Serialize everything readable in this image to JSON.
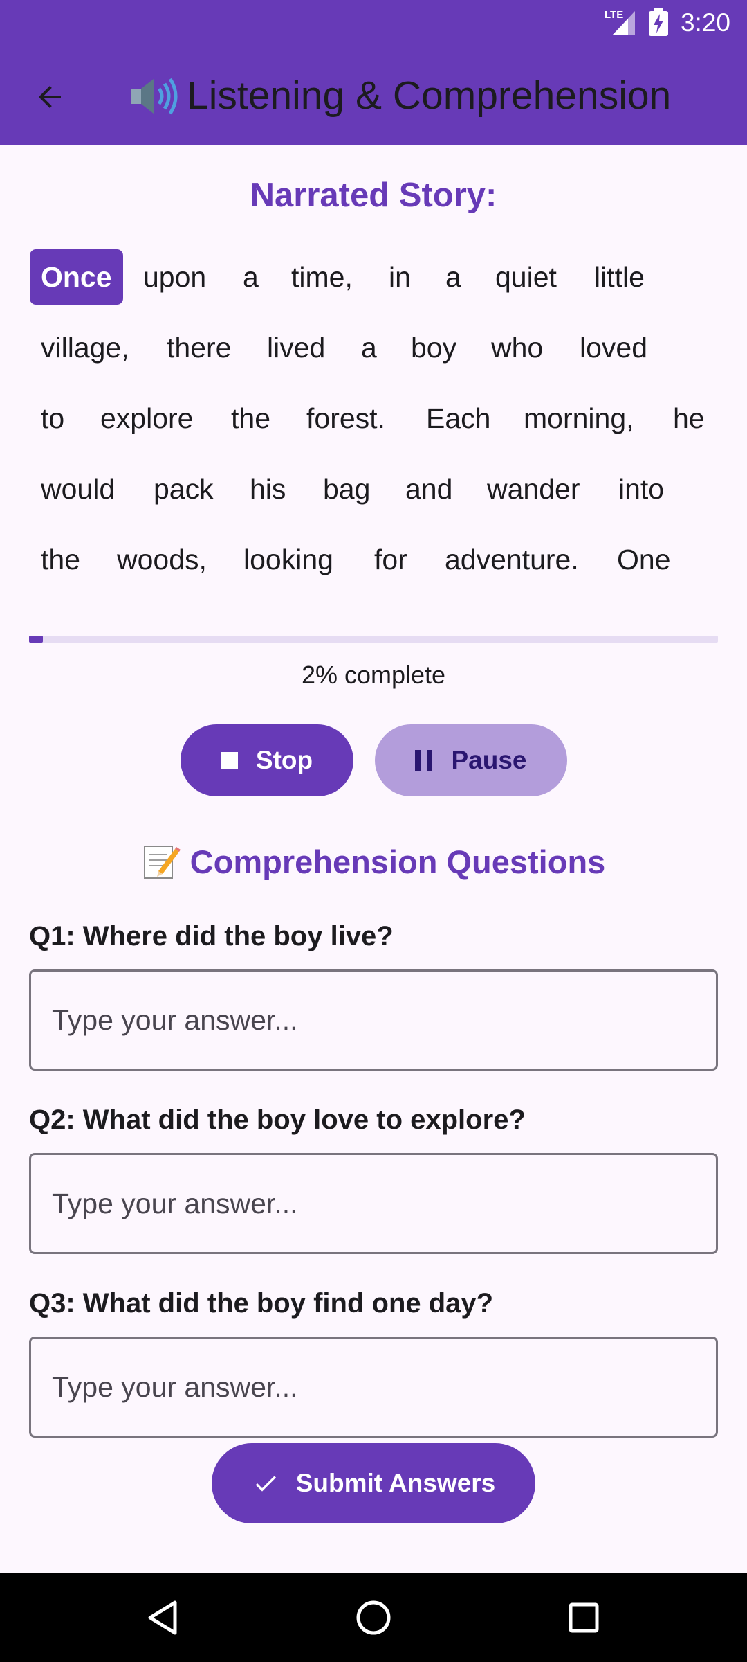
{
  "status_bar": {
    "time": "3:20",
    "network_label": "LTE",
    "icons": [
      "lte-signal-icon",
      "battery-charging-icon"
    ]
  },
  "app_bar": {
    "title": "Listening & Comprehension",
    "back_icon": "arrow-back-icon",
    "title_icon": "speaker-icon"
  },
  "story": {
    "heading": "Narrated Story:",
    "active_word_index": 0,
    "lines": [
      [
        "Once",
        "upon",
        "a",
        "time,",
        "in",
        "a",
        "quiet",
        "little"
      ],
      [
        "village,",
        "there",
        "lived",
        "a",
        "boy",
        "who",
        "loved"
      ],
      [
        "to",
        "explore",
        "the",
        "forest.",
        "Each",
        "morning,",
        "he"
      ],
      [
        "would",
        "pack",
        "his",
        "bag",
        "and",
        "wander",
        "into"
      ],
      [
        "the",
        "woods,",
        "looking",
        "for",
        "adventure.",
        "One"
      ]
    ],
    "progress_percent": 2,
    "progress_text": "2% complete"
  },
  "controls": {
    "stop_label": "Stop",
    "pause_label": "Pause"
  },
  "questions": {
    "heading": "Comprehension Questions",
    "heading_icon": "memo-icon",
    "items": [
      {
        "label": "Q1: Where did the boy live?",
        "placeholder": "Type your answer...",
        "value": ""
      },
      {
        "label": "Q2: What did the boy love to explore?",
        "placeholder": "Type your answer...",
        "value": ""
      },
      {
        "label": "Q3: What did the boy find one day?",
        "placeholder": "Type your answer...",
        "value": ""
      }
    ],
    "submit_label": "Submit Answers"
  },
  "nav_bar": {
    "icons": [
      "nav-back-icon",
      "nav-home-icon",
      "nav-recents-icon"
    ]
  },
  "colors": {
    "primary": "#673ab7",
    "secondary_button": "#b39ddb",
    "background": "#fdf7fe",
    "progress_track": "#e6dcf3"
  }
}
